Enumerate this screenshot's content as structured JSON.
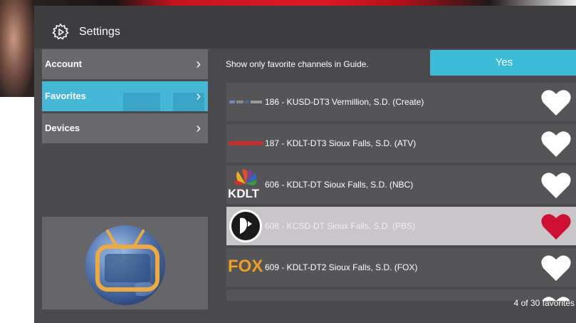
{
  "header": {
    "title": "Settings"
  },
  "sidebar": {
    "items": [
      {
        "label": "Account",
        "chevron": "›"
      },
      {
        "label": "Favorites",
        "chevron": "›"
      },
      {
        "label": "Devices",
        "chevron": "›"
      }
    ]
  },
  "favorites_toggle": {
    "label": "Show only favorite channels in Guide.",
    "value": "Yes"
  },
  "channels": [
    {
      "name": "186 - KUSD-DT3 Vermillion, S.D. (Create)",
      "favorite": true
    },
    {
      "name": "187 - KDLT-DT3 Sioux Falls, S.D. (ATV)",
      "favorite": true
    },
    {
      "name": "606 - KDLT-DT Sioux Falls, S.D. (NBC)",
      "favorite": true,
      "logo_text": "KDLT"
    },
    {
      "name": "608 - KCSD-DT Sioux Falls, S.D. (PBS)",
      "favorite": true
    },
    {
      "name": "609 - KDLT-DT2 Sioux Falls, S.D. (FOX)",
      "favorite": true,
      "logo_text": "FOX"
    }
  ],
  "footer": {
    "count": "4 of 30 favorites"
  },
  "colors": {
    "accent": "#3cbcd8",
    "heart_white": "#ffffff",
    "heart_selected": "#d01030",
    "fox": "#f0a020"
  },
  "icons": {
    "settings": "gear-icon",
    "chevron": "chevron-right-icon",
    "favorite": "heart-icon",
    "app_logo": "tv-globe-logo"
  }
}
